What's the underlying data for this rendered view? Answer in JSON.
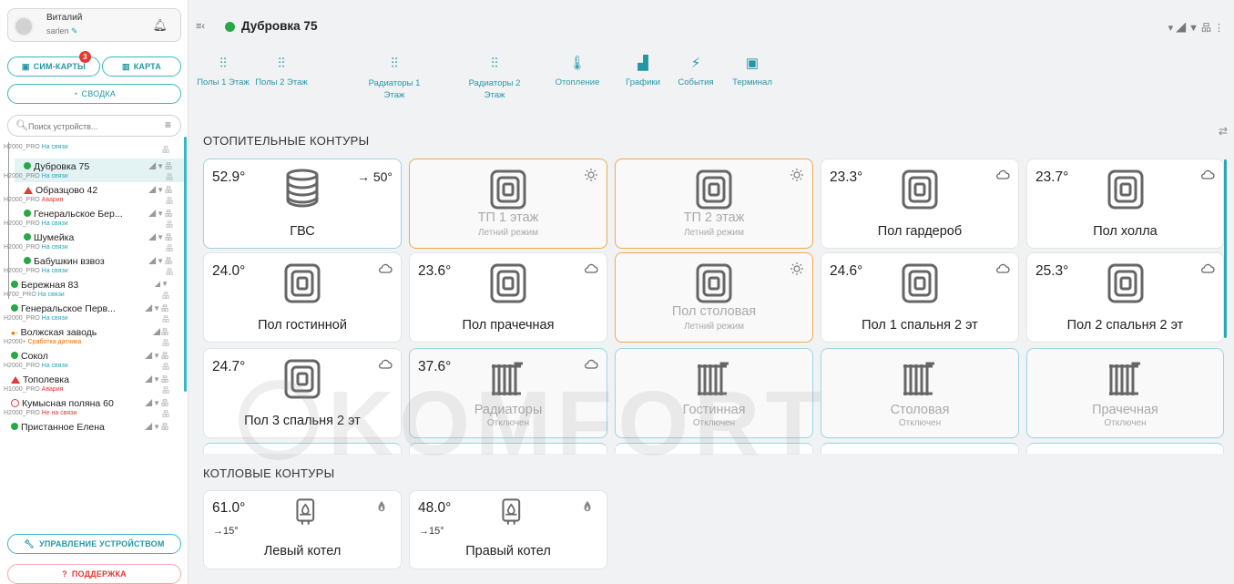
{
  "user": {
    "name": "Виталий",
    "login": "sarlen"
  },
  "sidebar": {
    "sim_button": "СИМ-КАРТЫ",
    "sim_badge": "3",
    "map_button": "КАРТА",
    "summary_button": "СВОДКА",
    "search_placeholder": "Поиск устройств...",
    "manage_button": "УПРАВЛЕНИЕ УСТРОЙСТВОМ",
    "support_button": "ПОДДЕРЖКА",
    "devices": [
      {
        "name": "",
        "model": "H2000_PRO",
        "status": "На связи"
      },
      {
        "name": "Дубровка 75",
        "model": "H2000_PRO",
        "status": "На связи"
      },
      {
        "name": "Образцово 42",
        "model": "H2000_PRO",
        "status": "Авария"
      },
      {
        "name": "Генеральское Бер...",
        "model": "H2000_PRO",
        "status": "На связи"
      },
      {
        "name": "Шумейка",
        "model": "H2000_PRO",
        "status": "На связи"
      },
      {
        "name": "Бабушкин взвоз",
        "model": "H2000_PRO",
        "status": "На связи"
      },
      {
        "name": "Бережная 83",
        "model": "H700_PRO",
        "status": "На связи"
      },
      {
        "name": "Генеральское Перв...",
        "model": "H2000_PRO",
        "status": "На связи"
      },
      {
        "name": "Волжская заводь",
        "model": "H2000+",
        "status": "Сработка датчика"
      },
      {
        "name": "Сокол",
        "model": "H2000_PRO",
        "status": "На связи"
      },
      {
        "name": "Тополевка",
        "model": "H1000_PRO",
        "status": "Авария"
      },
      {
        "name": "Кумысная поляна 60",
        "model": "H2000_PRO",
        "status": "Не на связи"
      },
      {
        "name": "Пристанное Елена",
        "model": "",
        "status": ""
      }
    ]
  },
  "header": {
    "title": "Дубровка 75"
  },
  "tabs": [
    {
      "label": "Полы 1 Этаж"
    },
    {
      "label": "Полы 2 Этаж"
    },
    {
      "label": "Радиаторы 1 Этаж"
    },
    {
      "label": "Радиаторы 2 Этаж"
    },
    {
      "label": "Отопление"
    },
    {
      "label": "Графики"
    },
    {
      "label": "События"
    },
    {
      "label": "Терминал"
    }
  ],
  "heating": {
    "title": "ОТОПИТЕЛЬНЫЕ КОНТУРЫ",
    "cards": [
      {
        "temp": "52.9°",
        "target": "→ 50°",
        "title": "ГВС",
        "sub": ""
      },
      {
        "temp": "",
        "title": "ТП 1 этаж",
        "sub": "Летний режим"
      },
      {
        "temp": "",
        "title": "ТП 2 этаж",
        "sub": "Летний режим"
      },
      {
        "temp": "23.3°",
        "title": "Пол гардероб",
        "sub": ""
      },
      {
        "temp": "23.7°",
        "title": "Пол холла",
        "sub": ""
      },
      {
        "temp": "24.0°",
        "title": "Пол гостинной",
        "sub": ""
      },
      {
        "temp": "23.6°",
        "title": "Пол прачечная",
        "sub": ""
      },
      {
        "temp": "",
        "title": "Пол столовая",
        "sub": "Летний режим"
      },
      {
        "temp": "24.6°",
        "title": "Пол 1 спальня 2 эт",
        "sub": ""
      },
      {
        "temp": "25.3°",
        "title": "Пол 2 спальня 2 эт",
        "sub": ""
      },
      {
        "temp": "24.7°",
        "title": "Пол 3 спальня 2 эт",
        "sub": ""
      },
      {
        "temp": "37.6°",
        "title": "Радиаторы",
        "sub": "Отключен"
      },
      {
        "temp": "",
        "title": "Гостинная",
        "sub": "Отключен"
      },
      {
        "temp": "",
        "title": "Столовая",
        "sub": "Отключен"
      },
      {
        "temp": "",
        "title": "Прачечная",
        "sub": "Отключен"
      }
    ]
  },
  "boilers": {
    "title": "КОТЛОВЫЕ КОНТУРЫ",
    "cards": [
      {
        "temp": "61.0°",
        "setpoint": "→15°",
        "title": "Левый котел"
      },
      {
        "temp": "48.0°",
        "setpoint": "→15°",
        "title": "Правый котел"
      }
    ]
  },
  "watermark": "KOMFORT",
  "colors": {
    "accent": "#2aa6b4",
    "online": "#27a844",
    "alarm": "#e53935",
    "summer": "#f0a950"
  }
}
